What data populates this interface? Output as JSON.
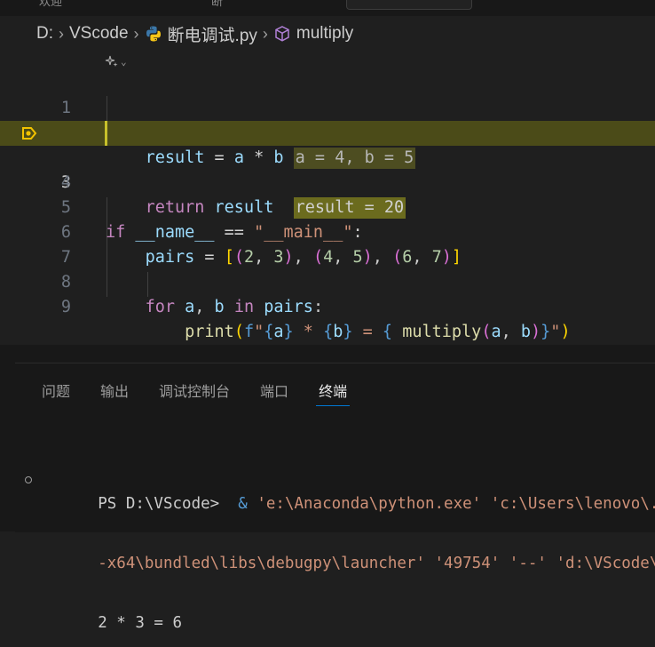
{
  "tabbar": {
    "left_tab_text": "欢迎",
    "right_tab_text": "断"
  },
  "breadcrumb": {
    "drive": "D:",
    "folder": "VScode",
    "file": "断电调试.py",
    "symbol": "multiply"
  },
  "editor": {
    "lines": [
      {
        "n": "1"
      },
      {
        "n": "2"
      },
      {
        "n": "3"
      },
      {
        "n": "4"
      },
      {
        "n": "5"
      },
      {
        "n": "6"
      },
      {
        "n": "7"
      },
      {
        "n": "8"
      },
      {
        "n": "9"
      }
    ],
    "inline_values": {
      "line2": "a = 4, b = 5",
      "line3": "result = 20"
    },
    "current_line": 3
  },
  "panel": {
    "tabs": [
      "问题",
      "输出",
      "调试控制台",
      "端口",
      "终端"
    ],
    "active_tab": "终端"
  },
  "terminal": {
    "prompt": "PS D:\\VScode> ",
    "cmd_amp": " & ",
    "line1_args": "'e:\\Anaconda\\python.exe' 'c:\\Users\\lenovo\\.vsco",
    "line2_a": "-x64\\bundled\\libs\\debugpy\\launcher' '49754' '--' 'd:\\VScode\\断电",
    "output": "2 * 3 = 6"
  },
  "colors": {
    "debug_line_bg": "#4b4b18",
    "accent": "#0078d4",
    "breakpoint_arrow": "#f2c200"
  }
}
